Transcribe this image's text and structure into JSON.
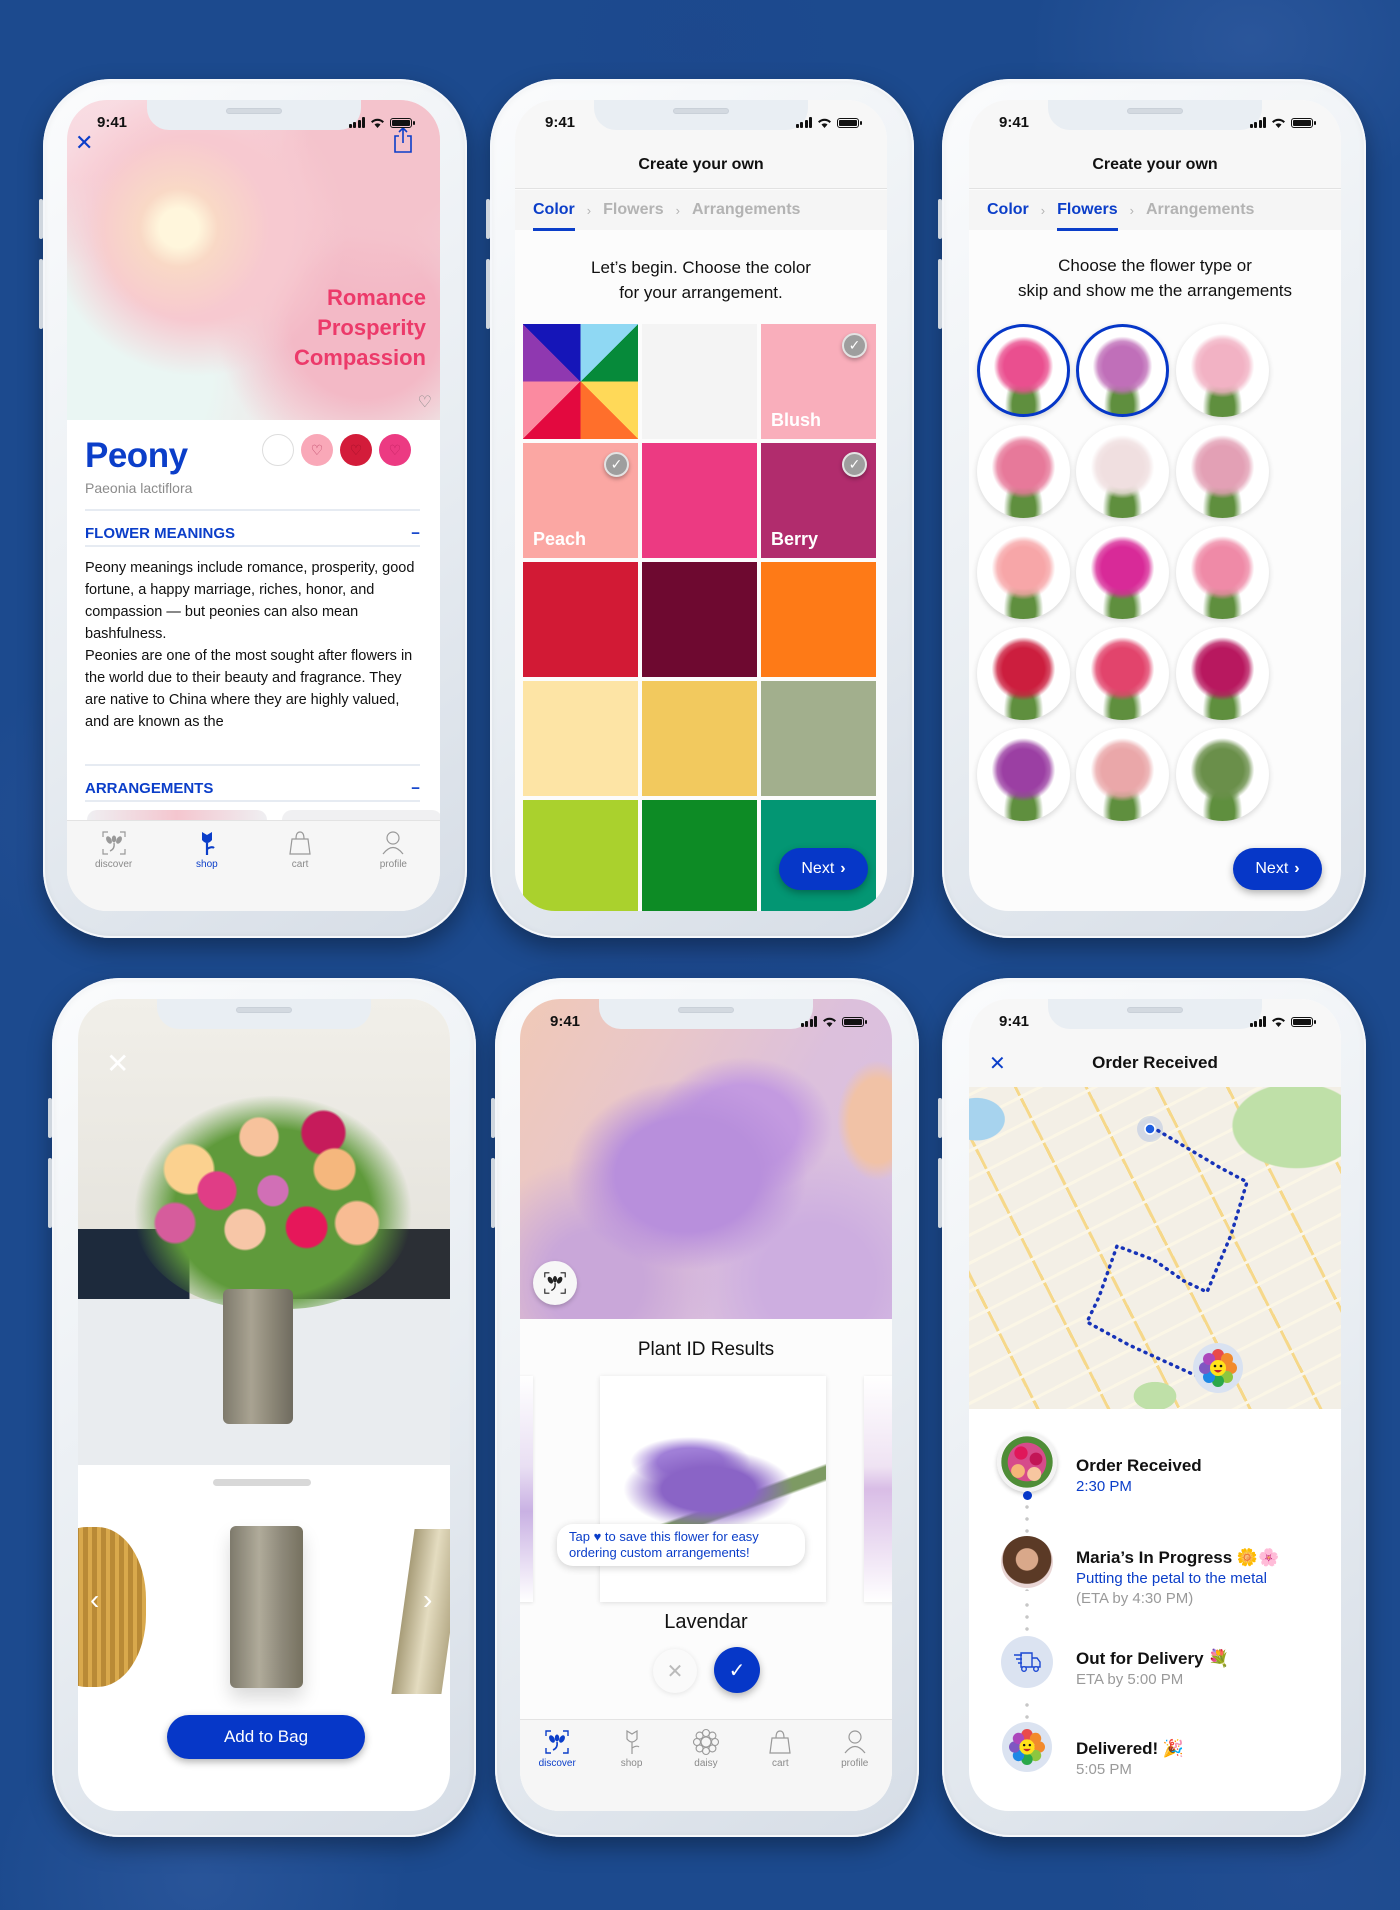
{
  "status_time": "9:41",
  "screen1": {
    "meanings_overlay": [
      "Romance",
      "Prosperity",
      "Compassion"
    ],
    "flower_name": "Peony",
    "latin_name": "Paeonia lactiflora",
    "color_options": [
      "#ffffff",
      "#f9a8b8",
      "#d31c3a",
      "#ec3a82"
    ],
    "sections": [
      {
        "title": "FLOWER MEANINGS",
        "toggle": "−"
      },
      {
        "title": "ARRANGEMENTS",
        "toggle": "−"
      }
    ],
    "paragraph1": "Peony meanings include romance, prosperity, good fortune, a happy marriage, riches, honor, and compassion — but peonies can also mean bashfulness.",
    "paragraph2": "Peonies are one of the most sought after flowers in the world due to their beauty and fragrance. They are native to China where they are highly valued, and are known as the",
    "tabs": [
      {
        "label": "discover",
        "icon": "discover-icon",
        "active": false
      },
      {
        "label": "shop",
        "icon": "rose-icon",
        "active": true
      },
      {
        "label": "cart",
        "icon": "bag-icon",
        "active": false
      },
      {
        "label": "profile",
        "icon": "person-icon",
        "active": false
      }
    ]
  },
  "screen2": {
    "title": "Create your own",
    "crumbs": [
      "Color",
      "Flowers",
      "Arrangements"
    ],
    "active_step": 0,
    "prompt_line1": "Let’s begin. Choose the color",
    "prompt_line2": "for your arrangement.",
    "swatches": [
      {
        "name": "Multicolor",
        "color": "multi",
        "label": "",
        "selected": false
      },
      {
        "name": "White",
        "color": "#f4f4f4",
        "label": "",
        "selected": false
      },
      {
        "name": "Blush",
        "color": "#f9aebb",
        "label": "Blush",
        "selected": true
      },
      {
        "name": "Peach",
        "color": "#fba7a3",
        "label": "Peach",
        "selected": true
      },
      {
        "name": "Hot Pink",
        "color": "#ec3a82",
        "label": "",
        "selected": false
      },
      {
        "name": "Berry",
        "color": "#b12c6d",
        "label": "Berry",
        "selected": true
      },
      {
        "name": "Red",
        "color": "#d21a35",
        "label": "",
        "selected": false
      },
      {
        "name": "Burgundy",
        "color": "#6e0930",
        "label": "",
        "selected": false
      },
      {
        "name": "Orange",
        "color": "#fe7a17",
        "label": "",
        "selected": false
      },
      {
        "name": "Cream",
        "color": "#fde4a5",
        "label": "",
        "selected": false
      },
      {
        "name": "Yellow",
        "color": "#f2c95e",
        "label": "",
        "selected": false
      },
      {
        "name": "Sage",
        "color": "#a2af8d",
        "label": "",
        "selected": false
      },
      {
        "name": "Lime",
        "color": "#aad12d",
        "label": "",
        "selected": false
      },
      {
        "name": "Green",
        "color": "#0d8b25",
        "label": "",
        "selected": false
      },
      {
        "name": "Teal",
        "color": "#039673",
        "label": "",
        "selected": false
      }
    ],
    "next_label": "Next"
  },
  "screen3": {
    "title": "Create your own",
    "crumbs": [
      "Color",
      "Flowers",
      "Arrangements"
    ],
    "active_step": 1,
    "prompt_line1": "Choose the flower type or",
    "prompt_line2": "skip and show me the arrangements",
    "flowers": [
      {
        "name": "pink rose",
        "color": "#ea4f8f",
        "selected": true
      },
      {
        "name": "lavender rose",
        "color": "#c06fb9",
        "selected": true
      },
      {
        "name": "pink lily",
        "color": "#f2b2c4",
        "selected": false
      },
      {
        "name": "stargazer lily",
        "color": "#e7799a",
        "selected": false
      },
      {
        "name": "white orchid",
        "color": "#f0dfe0",
        "selected": false
      },
      {
        "name": "pink orchid",
        "color": "#e3a0b5",
        "selected": false
      },
      {
        "name": "pink gerbera",
        "color": "#f7a6a8",
        "selected": false
      },
      {
        "name": "magenta gerbera",
        "color": "#d82a98",
        "selected": false
      },
      {
        "name": "pink alstroemeria",
        "color": "#ef8aa7",
        "selected": false
      },
      {
        "name": "red alstroemeria",
        "color": "#cc1e3e",
        "selected": false
      },
      {
        "name": "spray rose",
        "color": "#e2446c",
        "selected": false
      },
      {
        "name": "magenta stock",
        "color": "#b8185f",
        "selected": false
      },
      {
        "name": "purple stock",
        "color": "#9b3fa3",
        "selected": false
      },
      {
        "name": "snapdragon",
        "color": "#eaa7a9",
        "selected": false
      },
      {
        "name": "lisianthus",
        "color": "#6a8f4a",
        "selected": false
      }
    ],
    "next_label": "Next"
  },
  "screen4": {
    "add_label": "Add to Bag",
    "vases": [
      "gold ribbed vase",
      "mercury glass vase",
      "champagne folded vase"
    ]
  },
  "screen5": {
    "results_title": "Plant ID Results",
    "tooltip": "Tap ♥ to save this flower for easy ordering custom arrangements!",
    "result_name": "Lavendar",
    "tabs": [
      {
        "label": "discover",
        "icon": "discover-icon",
        "active": true
      },
      {
        "label": "shop",
        "icon": "rose-icon",
        "active": false
      },
      {
        "label": "daisy",
        "icon": "daisy-icon",
        "active": false
      },
      {
        "label": "cart",
        "icon": "bag-icon",
        "active": false
      },
      {
        "label": "profile",
        "icon": "person-icon",
        "active": false
      }
    ]
  },
  "screen6": {
    "title": "Order Received",
    "timeline": [
      {
        "title": "Order Received",
        "sub": "2:30 PM",
        "sub_style": "blue",
        "extra": ""
      },
      {
        "title": "Maria’s In Progress 🌼🌸",
        "sub": "Putting the petal to the metal",
        "sub_style": "blue",
        "extra": "(ETA by 4:30 PM)"
      },
      {
        "title": "Out for Delivery 💐",
        "sub": "ETA by 5:00 PM",
        "sub_style": "gray",
        "extra": ""
      },
      {
        "title": "Delivered! 🎉",
        "sub": "5:05 PM",
        "sub_style": "gray",
        "extra": ""
      }
    ]
  },
  "colors": {
    "accent": "#0637c8",
    "link": "#0b3ec9",
    "overlay_text": "#ec3a6a",
    "background": "#1c4a8e"
  }
}
